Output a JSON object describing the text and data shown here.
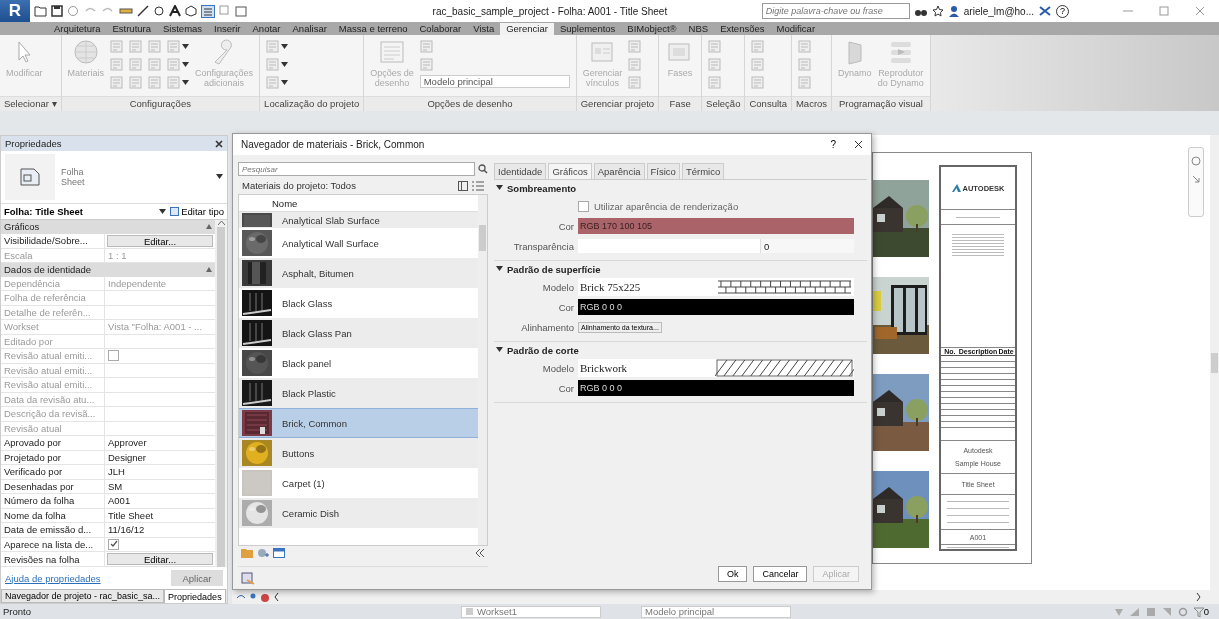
{
  "title_bar": {
    "app_button": "R",
    "title": "rac_basic_sample_project - Folha: A001 - Title Sheet",
    "search": {
      "placeholder": "Digite palavra-chave ou frase"
    },
    "user": "ariele_lm@ho...",
    "help": "?"
  },
  "ribbon": {
    "tabs": [
      {
        "label": "Arquitetura",
        "selected": false
      },
      {
        "label": "Estrutura",
        "selected": false
      },
      {
        "label": "Sistemas",
        "selected": false
      },
      {
        "label": "Inserir",
        "selected": false
      },
      {
        "label": "Anotar",
        "selected": false
      },
      {
        "label": "Analisar",
        "selected": false
      },
      {
        "label": "Massa e terreno",
        "selected": false
      },
      {
        "label": "Colaborar",
        "selected": false
      },
      {
        "label": "Vista",
        "selected": false
      },
      {
        "label": "Gerenciar",
        "selected": true
      },
      {
        "label": "Suplementos",
        "selected": false
      },
      {
        "label": "BIMobject®",
        "selected": false
      },
      {
        "label": "NBS",
        "selected": false
      },
      {
        "label": "Extensões",
        "selected": false
      },
      {
        "label": "Modificar",
        "selected": false
      }
    ],
    "panels": [
      {
        "label": "Selecionar ▾",
        "tools": [
          {
            "kind": "large",
            "label": "Modificar"
          }
        ]
      },
      {
        "label": "Configurações",
        "tools": [
          {
            "kind": "large",
            "label": "Materiais"
          },
          {
            "kind": "stack"
          },
          {
            "kind": "stack"
          },
          {
            "kind": "stack"
          },
          {
            "kind": "dropstack"
          },
          {
            "kind": "large",
            "label": "Configurações\nadicionais"
          }
        ]
      },
      {
        "label": "Localização do projeto",
        "tools": [
          {
            "kind": "dropstack"
          }
        ]
      },
      {
        "label": "Opções de desenho",
        "tools": [
          {
            "kind": "large",
            "label": "Opções de\ndesenho"
          },
          {
            "kind": "combo",
            "value": "Modelo principal"
          }
        ]
      },
      {
        "label": "Gerenciar projeto",
        "tools": [
          {
            "kind": "large",
            "label": "Gerenciar\nvínculos"
          },
          {
            "kind": "stack"
          }
        ]
      },
      {
        "label": "Fase",
        "tools": [
          {
            "kind": "large",
            "label": "Fases"
          }
        ]
      },
      {
        "label": "Seleção",
        "tools": [
          {
            "kind": "stack"
          }
        ]
      },
      {
        "label": "Consulta",
        "tools": [
          {
            "kind": "stack"
          }
        ]
      },
      {
        "label": "Macros",
        "tools": [
          {
            "kind": "stack"
          }
        ]
      },
      {
        "label": "Programação visual",
        "tools": [
          {
            "kind": "large",
            "label": "Dynamo"
          },
          {
            "kind": "large",
            "label": "Reprodutor\ndo Dynamo"
          }
        ]
      }
    ]
  },
  "properties": {
    "title": "Propriedades",
    "type_name": "Folha",
    "type_sub": "Sheet",
    "instance": "Folha: Title Sheet",
    "edit_type": "Editar tipo",
    "groups": [
      {
        "label": "Gráficos",
        "rows": [
          {
            "name": "Visibilidade/Sobre...",
            "value": "Editar...",
            "kind": "button",
            "disabled": false
          },
          {
            "name": "Escala",
            "value": "1 : 1",
            "kind": "text",
            "disabled": true
          }
        ]
      },
      {
        "label": "Dados de identidade",
        "rows": [
          {
            "name": "Dependência",
            "value": "Independente",
            "kind": "text",
            "disabled": true
          },
          {
            "name": "Folha de referência",
            "kind": "text",
            "disabled": true
          },
          {
            "name": "Detalhe de referên...",
            "kind": "text",
            "disabled": true
          },
          {
            "name": "Workset",
            "value": "Vista \"Folha: A001 - ...",
            "kind": "text",
            "disabled": true
          },
          {
            "name": "Editado por",
            "kind": "text",
            "disabled": true
          },
          {
            "name": "Revisão atual emiti...",
            "kind": "checkbox",
            "checked": false,
            "disabled": true
          },
          {
            "name": "Revisão atual emiti...",
            "kind": "text",
            "disabled": true
          },
          {
            "name": "Revisão atual emiti...",
            "kind": "text",
            "disabled": true
          },
          {
            "name": "Data da revisão atu...",
            "kind": "text",
            "disabled": true
          },
          {
            "name": "Descrição da revisã...",
            "kind": "text",
            "disabled": true
          },
          {
            "name": "Revisão atual",
            "kind": "text",
            "disabled": true
          },
          {
            "name": "Aprovado por",
            "value": "Approver",
            "kind": "text",
            "disabled": false
          },
          {
            "name": "Projetado por",
            "value": "Designer",
            "kind": "text",
            "disabled": false
          },
          {
            "name": "Verificado por",
            "value": "JLH",
            "kind": "text",
            "disabled": false
          },
          {
            "name": "Desenhadas por",
            "value": "SM",
            "kind": "text",
            "disabled": false
          },
          {
            "name": "Número da folha",
            "value": "A001",
            "kind": "text",
            "disabled": false
          },
          {
            "name": "Nome da folha",
            "value": "Title Sheet",
            "kind": "text",
            "disabled": false
          },
          {
            "name": "Data de emissão d...",
            "value": "11/16/12",
            "kind": "text",
            "disabled": false
          },
          {
            "name": "Aparece na lista de...",
            "kind": "checkbox",
            "checked": true,
            "disabled": false
          },
          {
            "name": "Revisões na folha",
            "value": "Editar...",
            "kind": "button",
            "disabled": false
          }
        ]
      }
    ],
    "help_link": "Ajuda de propriedades",
    "apply": "Aplicar",
    "bottom_tabs": [
      {
        "label": "Navegador de projeto - rac_basic_sa...",
        "selected": false
      },
      {
        "label": "Propriedades",
        "selected": true
      }
    ]
  },
  "dialog": {
    "title": "Navegador de materiais - Brick, Common",
    "help": "?",
    "browser": {
      "search": {
        "placeholder": "Pesquisar"
      },
      "filter": "Materiais do projeto: Todos",
      "column": "Nome",
      "items": [
        {
          "name": "Analytical Slab Surface",
          "kind": "flat",
          "color": "#4a4a4a",
          "selected": false
        },
        {
          "name": "Analytical Wall Surface",
          "kind": "sphere",
          "color": "#6a6a6a",
          "selected": false
        },
        {
          "name": "Asphalt, Bitumen",
          "kind": "cylinder",
          "color": "#3a3a3a",
          "selected": false
        },
        {
          "name": "Black Glass",
          "kind": "glass",
          "color": "#141414",
          "selected": false
        },
        {
          "name": "Black Glass Pan",
          "kind": "glass",
          "color": "#141414",
          "selected": false
        },
        {
          "name": "Black panel",
          "kind": "sphere",
          "color": "#555555",
          "selected": false
        },
        {
          "name": "Black Plastic",
          "kind": "glass",
          "color": "#181818",
          "selected": false
        },
        {
          "name": "Brick, Common",
          "kind": "brick",
          "color": "#7a3a46",
          "selected": true
        },
        {
          "name": "Buttons",
          "kind": "sphere",
          "color": "#e0b020",
          "selected": false
        },
        {
          "name": "Carpet (1)",
          "kind": "flat",
          "color": "#c8c5bf",
          "selected": false
        },
        {
          "name": "Ceramic Dish",
          "kind": "sphere",
          "color": "#e4e4e4",
          "selected": false
        }
      ]
    },
    "tabs": [
      {
        "label": "Identidade",
        "selected": false
      },
      {
        "label": "Gráficos",
        "selected": true
      },
      {
        "label": "Aparência",
        "selected": false
      },
      {
        "label": "Físico",
        "selected": false
      },
      {
        "label": "Térmico",
        "selected": false
      }
    ],
    "sections": [
      {
        "title": "Sombreamento",
        "rows": [
          {
            "kind": "checkbox",
            "label": "Utilizar aparência de renderização",
            "checked": false
          },
          {
            "kind": "color",
            "label": "Cor",
            "value": "RGB 170 100 105",
            "color": "#aa6469"
          },
          {
            "kind": "slider",
            "label": "Transparência",
            "level": 0,
            "value": "0"
          }
        ]
      },
      {
        "title": "Padrão de superfície",
        "rows": [
          {
            "kind": "bricks",
            "label": "Modelo",
            "value": "Brick 75x225"
          },
          {
            "kind": "color",
            "label": "Cor",
            "value": "RGB 0 0 0",
            "color": "#000000"
          },
          {
            "kind": "button",
            "label": "Alinhamento",
            "value": "Alinhamento da textura..."
          }
        ]
      },
      {
        "title": "Padrão de corte",
        "rows": [
          {
            "kind": "hatch",
            "label": "Modelo",
            "value": "Brickwork"
          },
          {
            "kind": "color",
            "label": "Cor",
            "value": "RGB 0 0 0",
            "color": "#000000"
          }
        ]
      }
    ],
    "buttons": [
      {
        "label": "Ok",
        "disabled": false
      },
      {
        "label": "Cancelar",
        "disabled": false
      },
      {
        "label": "Aplicar",
        "disabled": true
      }
    ]
  },
  "sheet": {
    "photos": [
      {
        "kind": "picture"
      },
      {
        "kind": "picture"
      },
      {
        "kind": "picture"
      },
      {
        "kind": "picture"
      }
    ],
    "logo": "AUTODESK",
    "revision_columns": [
      "No.",
      "Description",
      "Date"
    ],
    "client": "Autodesk",
    "project": "Sample House",
    "sheet_name": "Title Sheet",
    "sheet_number": "A001"
  },
  "status_bar": {
    "text": "Pronto",
    "workset": "Workset1",
    "design_option": "Modelo principal",
    "filter_count": "0"
  }
}
